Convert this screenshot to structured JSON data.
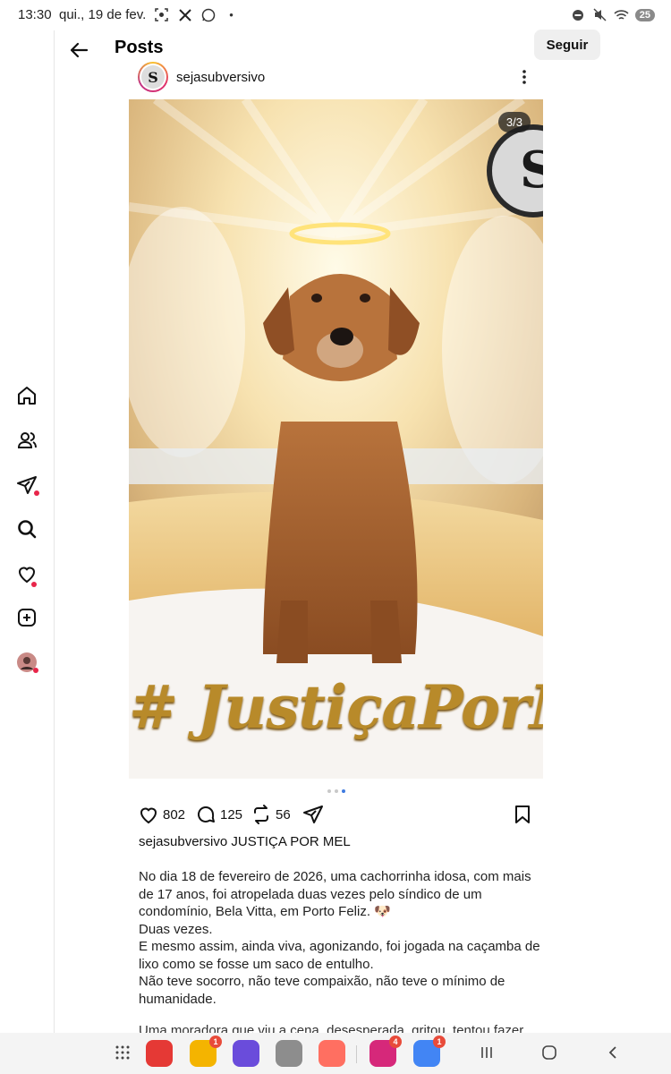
{
  "status_bar": {
    "time": "13:30",
    "date": "qui., 19 de fev.",
    "battery": "25",
    "left_icons": [
      "screenshot-icon",
      "x-icon",
      "whatsapp-icon",
      "dot-icon"
    ],
    "right_icons": [
      "do-not-disturb-icon",
      "mute-icon",
      "wifi-icon"
    ]
  },
  "header": {
    "title": "Posts",
    "follow_label": "Seguir"
  },
  "post": {
    "username": "sejasubversivo",
    "avatar_letter": "S",
    "image_counter": "3/3",
    "image_text": "# JustiçaPorMel",
    "avatar_in_image": "S",
    "carousel": {
      "count": 3,
      "active": 3
    },
    "likes": "802",
    "comments": "125",
    "reposts": "56",
    "caption_user": "sejasubversivo",
    "caption_title": "JUSTIÇA POR MEL",
    "body": [
      "No dia 18 de fevereiro de 2026, uma cachorrinha idosa, com mais de 17 anos, foi atropelada duas vezes pelo síndico de um condomínio, Bela Vitta, em Porto Feliz. 🐶",
      "Duas vezes.",
      "E mesmo assim, ainda viva, agonizando, foi jogada na caçamba de lixo como se fosse um saco de entulho.",
      "Não teve socorro, não teve compaixão, não teve o mínimo de humanidade."
    ],
    "cut_line": "Uma moradora que viu a cena, desesperada, gritou, tentou fazer"
  },
  "dock": {
    "apps": [
      {
        "name": "red-app",
        "color": "#e53935",
        "badge": ""
      },
      {
        "name": "notes-app",
        "color": "#f4b400",
        "badge": "1"
      },
      {
        "name": "browser-app",
        "color": "#6a4cdb",
        "badge": ""
      },
      {
        "name": "camera-app",
        "color": "#8d8d8d",
        "badge": ""
      },
      {
        "name": "photos-app",
        "color": "#ff6f61",
        "badge": ""
      },
      {
        "name": "instagram-app",
        "color": "#d6287a",
        "badge": "4"
      },
      {
        "name": "chrome-app",
        "color": "#4285f4",
        "badge": "1"
      }
    ]
  }
}
